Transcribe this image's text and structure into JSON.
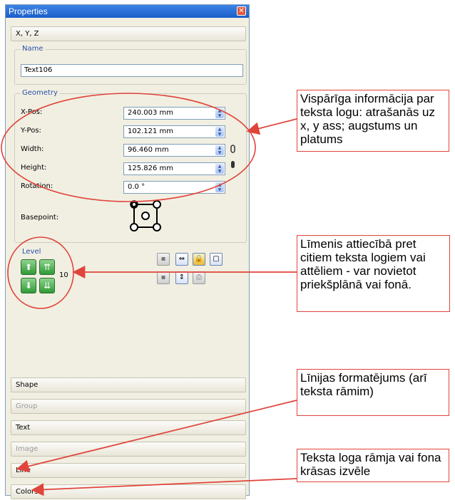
{
  "window": {
    "title": "Properties",
    "close_glyph": "✕"
  },
  "sections_top": {
    "xyz": "X, Y, Z"
  },
  "name_group": {
    "legend": "Name",
    "value": "Text106"
  },
  "geometry": {
    "legend": "Geometry",
    "fields": [
      {
        "label": "X-Pos:",
        "value": "240.003 mm"
      },
      {
        "label": "Y-Pos:",
        "value": "102.121 mm"
      },
      {
        "label": "Width:",
        "value": "96.460 mm"
      },
      {
        "label": "Height:",
        "value": "125.826 mm"
      },
      {
        "label": "Rotation:",
        "value": "0.0 °"
      }
    ],
    "basepoint_label": "Basepoint:"
  },
  "level": {
    "legend": "Level",
    "value": "10"
  },
  "sections_bottom": [
    {
      "label": "Shape",
      "enabled": true
    },
    {
      "label": "Group",
      "enabled": false
    },
    {
      "label": "Text",
      "enabled": true
    },
    {
      "label": "Image",
      "enabled": false
    },
    {
      "label": "Line",
      "enabled": true
    },
    {
      "label": "Colors",
      "enabled": true
    }
  ],
  "callouts": [
    "Vispārīga informācija par teksta logu: atrašanās uz x, y ass; augstums un platums",
    "Līmenis attiecībā pret citiem teksta logiem vai attēliem - var novietot priekšplānā vai fonā.",
    "Līnijas formatējums (arī teksta rāmim)",
    "Teksta loga rāmja vai fona krāsas izvēle"
  ],
  "colors": {
    "annotation": "#e0443a",
    "title_bar": "#2a6fd9",
    "panel": "#f1efe2"
  }
}
